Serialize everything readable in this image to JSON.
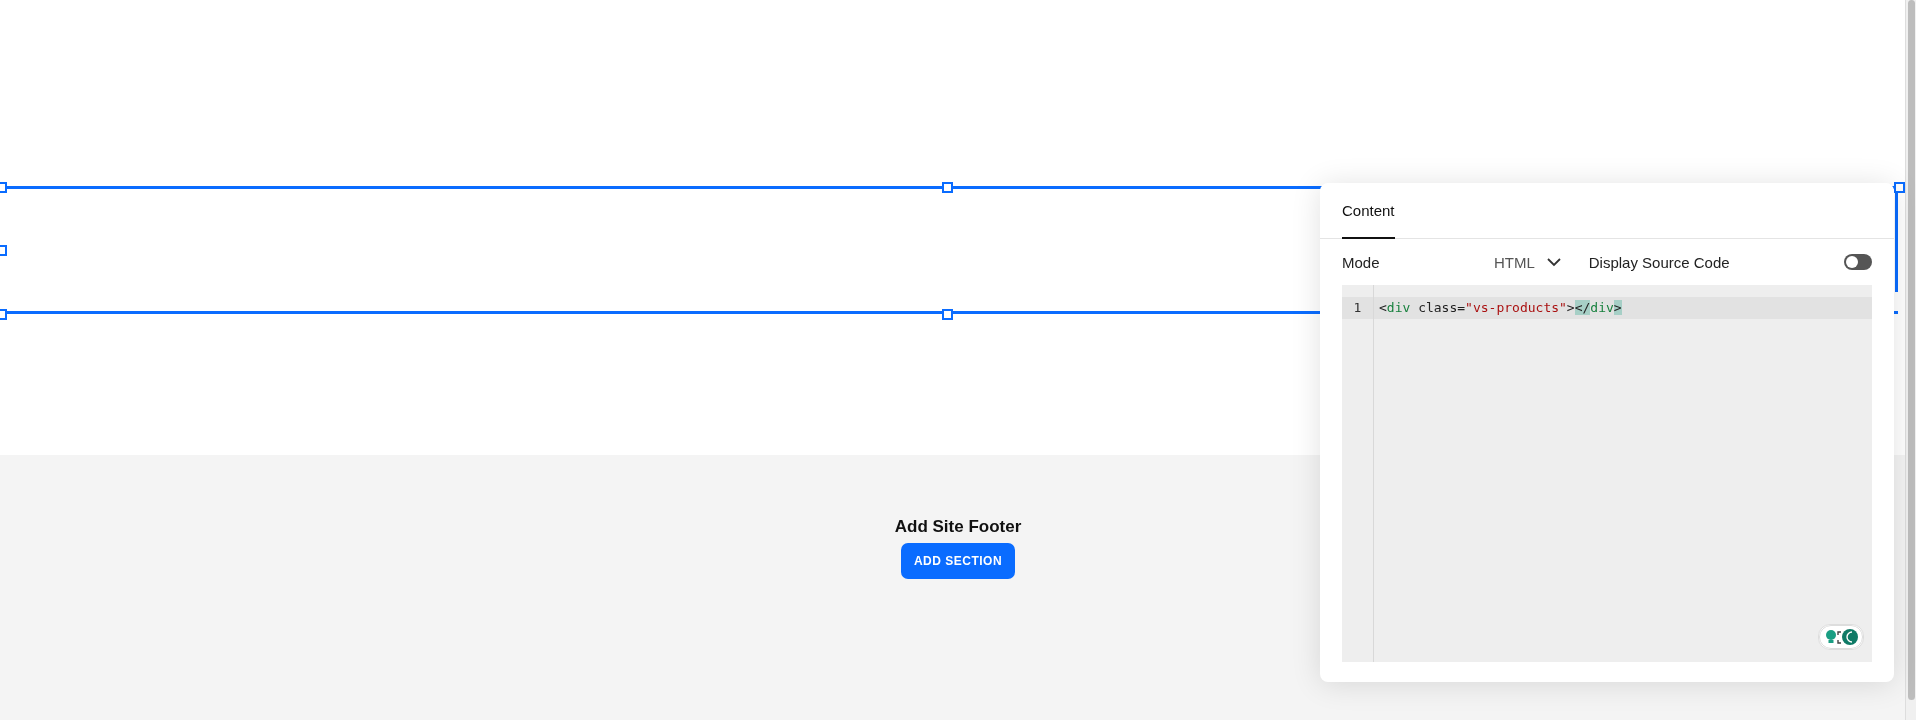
{
  "panel": {
    "tabs": [
      {
        "label": "Content",
        "selected": true
      }
    ],
    "mode": {
      "label": "Mode",
      "value": "HTML"
    },
    "display_source": {
      "label": "Display Source Code",
      "on": false
    },
    "editor": {
      "lines": [
        {
          "number": "1",
          "active": true,
          "tokens": [
            {
              "text": "<",
              "kind": "punct",
              "matched": false
            },
            {
              "text": "div",
              "kind": "tag",
              "matched": false
            },
            {
              "text": " class=",
              "kind": "attr",
              "matched": false
            },
            {
              "text": "\"vs-products\"",
              "kind": "string",
              "matched": false
            },
            {
              "text": ">",
              "kind": "punct",
              "matched": false
            },
            {
              "text": "</",
              "kind": "punct",
              "matched": true
            },
            {
              "text": "div",
              "kind": "tag",
              "matched": false
            },
            {
              "text": ">",
              "kind": "punct",
              "matched": true
            }
          ]
        }
      ]
    }
  },
  "footer": {
    "title": "Add Site Footer",
    "button": "ADD SECTION"
  }
}
